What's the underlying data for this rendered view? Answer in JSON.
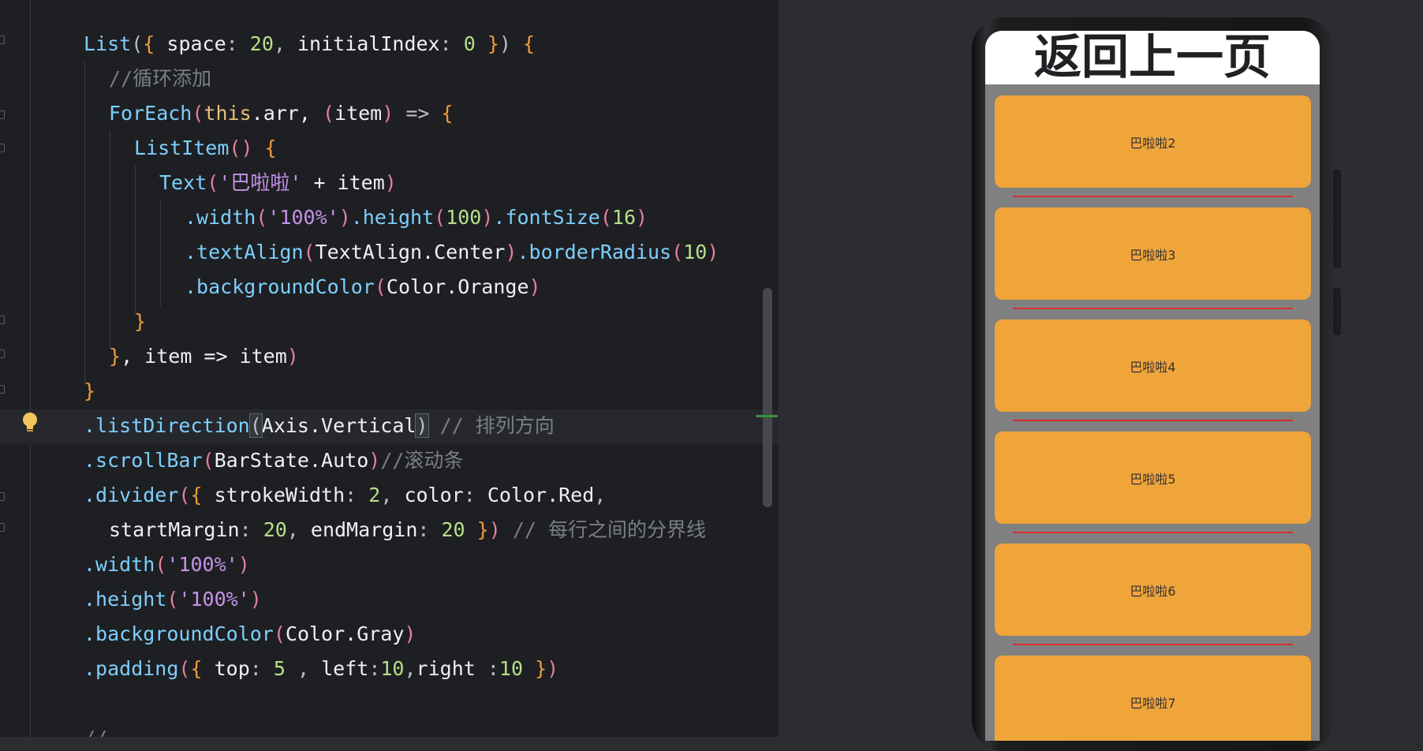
{
  "editor": {
    "lines": [
      [
        [
          "List",
          "f"
        ],
        [
          "(",
          "o"
        ],
        [
          "{",
          "b"
        ],
        [
          " space",
          "pl"
        ],
        [
          ": ",
          "o"
        ],
        [
          "20",
          "n"
        ],
        [
          ", ",
          "o"
        ],
        [
          "initialIndex",
          "pl"
        ],
        [
          ": ",
          "o"
        ],
        [
          "0",
          "n"
        ],
        [
          " }",
          "b"
        ],
        [
          ")",
          "o"
        ],
        [
          " {",
          "b"
        ]
      ],
      [
        [
          "//循环添加",
          "c"
        ]
      ],
      [
        [
          "ForEach",
          "f"
        ],
        [
          "(",
          "p"
        ],
        [
          "this",
          "k"
        ],
        [
          ".arr, ",
          "pl"
        ],
        [
          "(",
          "p"
        ],
        [
          "item",
          "pl"
        ],
        [
          ")",
          "p"
        ],
        [
          " => ",
          "o"
        ],
        [
          "{",
          "b"
        ]
      ],
      [
        [
          "ListItem",
          "f"
        ],
        [
          "()",
          "p"
        ],
        [
          " {",
          "b"
        ]
      ],
      [
        [
          "Text",
          "f"
        ],
        [
          "(",
          "p"
        ],
        [
          "'巴啦啦'",
          "s"
        ],
        [
          " + item",
          "pl"
        ],
        [
          ")",
          "p"
        ]
      ],
      [
        [
          ".width",
          "f"
        ],
        [
          "(",
          "p"
        ],
        [
          "'100%'",
          "s"
        ],
        [
          ")",
          "p"
        ],
        [
          ".height",
          "f"
        ],
        [
          "(",
          "p"
        ],
        [
          "100",
          "n"
        ],
        [
          ")",
          "p"
        ],
        [
          ".fontSize",
          "f"
        ],
        [
          "(",
          "p"
        ],
        [
          "16",
          "n"
        ],
        [
          ")",
          "p"
        ]
      ],
      [
        [
          ".textAlign",
          "f"
        ],
        [
          "(",
          "p"
        ],
        [
          "TextAlign",
          "pl"
        ],
        [
          ".Center",
          "pl"
        ],
        [
          ")",
          "p"
        ],
        [
          ".borderRadius",
          "f"
        ],
        [
          "(",
          "p"
        ],
        [
          "10",
          "n"
        ],
        [
          ")",
          "p"
        ]
      ],
      [
        [
          ".backgroundColor",
          "f"
        ],
        [
          "(",
          "p"
        ],
        [
          "Color",
          "pl"
        ],
        [
          ".Orange",
          "pl"
        ],
        [
          ")",
          "p"
        ]
      ],
      [
        [
          "}",
          "b"
        ]
      ],
      [
        [
          "}",
          "b"
        ],
        [
          ", item => item",
          "pl"
        ],
        [
          ")",
          "p"
        ]
      ],
      [
        [
          "}",
          "b"
        ]
      ],
      [
        [
          ".listDirection",
          "f"
        ],
        [
          "(",
          "bm"
        ],
        [
          "Axis",
          "pl"
        ],
        [
          ".Vertical",
          "pl"
        ],
        [
          ")",
          "bm"
        ],
        [
          " // 排列方向",
          "c"
        ]
      ],
      [
        [
          ".scrollBar",
          "f"
        ],
        [
          "(",
          "p"
        ],
        [
          "BarState",
          "pl"
        ],
        [
          ".Auto",
          "pl"
        ],
        [
          ")",
          "p"
        ],
        [
          "//滚动条",
          "c"
        ]
      ],
      [
        [
          ".divider",
          "f"
        ],
        [
          "(",
          "p"
        ],
        [
          "{",
          "b"
        ],
        [
          " strokeWidth",
          "pl"
        ],
        [
          ": ",
          "o"
        ],
        [
          "2",
          "n"
        ],
        [
          ", ",
          "o"
        ],
        [
          "color",
          "pl"
        ],
        [
          ": ",
          "o"
        ],
        [
          "Color.Red",
          "pl"
        ],
        [
          ",",
          "o"
        ]
      ],
      [
        [
          "startMargin",
          "pl"
        ],
        [
          ": ",
          "o"
        ],
        [
          "20",
          "n"
        ],
        [
          ", ",
          "o"
        ],
        [
          "endMargin",
          "pl"
        ],
        [
          ": ",
          "o"
        ],
        [
          "20",
          "n"
        ],
        [
          " }",
          "b"
        ],
        [
          ")",
          "p"
        ],
        [
          " // 每行之间的分界线",
          "c"
        ]
      ],
      [
        [
          ".width",
          "f"
        ],
        [
          "(",
          "p"
        ],
        [
          "'100%'",
          "s"
        ],
        [
          ")",
          "p"
        ]
      ],
      [
        [
          ".height",
          "f"
        ],
        [
          "(",
          "p"
        ],
        [
          "'100%'",
          "s"
        ],
        [
          ")",
          "p"
        ]
      ],
      [
        [
          ".backgroundColor",
          "f"
        ],
        [
          "(",
          "p"
        ],
        [
          "Color",
          "pl"
        ],
        [
          ".Gray",
          "pl"
        ],
        [
          ")",
          "p"
        ]
      ],
      [
        [
          ".padding",
          "f"
        ],
        [
          "(",
          "p"
        ],
        [
          "{",
          "b"
        ],
        [
          " top",
          "pl"
        ],
        [
          ": ",
          "o"
        ],
        [
          "5",
          "n"
        ],
        [
          " , ",
          "o"
        ],
        [
          "left",
          "pl"
        ],
        [
          ":",
          "o"
        ],
        [
          "10",
          "n"
        ],
        [
          ",",
          "o"
        ],
        [
          "right ",
          "pl"
        ],
        [
          ":",
          "o"
        ],
        [
          "10",
          "n"
        ],
        [
          " }",
          "b"
        ],
        [
          ")",
          "p"
        ]
      ],
      [],
      [
        [
          "//",
          "c"
        ]
      ]
    ]
  },
  "preview": {
    "title": "返回上一页",
    "items": [
      "巴啦啦2",
      "巴啦啦3",
      "巴啦啦4",
      "巴啦啦5",
      "巴啦啦6",
      "巴啦啦7"
    ]
  }
}
